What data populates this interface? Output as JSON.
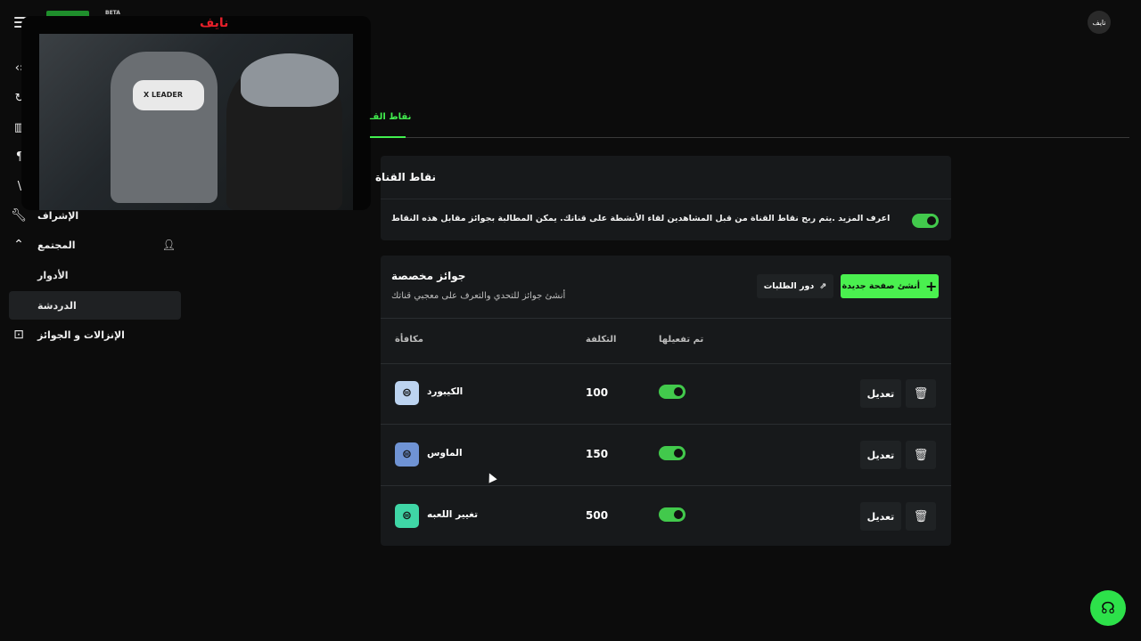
{
  "header": {
    "beta_label": "BETA",
    "user_initials": "نايف"
  },
  "stream_overlay": {
    "streamer_name": "نايف",
    "chair_brand": "X LEADER"
  },
  "sidebar": {
    "items": [
      {
        "label": "الإشراف",
        "icon": "wrench-icon"
      },
      {
        "label": "المجتمع",
        "icon": "chevron-up-icon"
      },
      {
        "label": "الأدوار"
      },
      {
        "label": "الدردشة"
      },
      {
        "label": "الإنزالات و الجوائز",
        "icon": "gift-drop-icon"
      }
    ]
  },
  "tab": {
    "active_label": "نقاط القـ"
  },
  "channel_points": {
    "title": "نقاط القناة",
    "description": "اعرف المزيد .يتم ربح نقاط القناة من قبل المشاهدين لقاء الأنشطة على قناتك. يمكن المطالبة بجوائز مقابل هذه النقاط",
    "enabled": true
  },
  "custom_rewards": {
    "title": "جوائز مخصصة",
    "subtitle": "أنشئ جوائز للتحدي والتعرف على معجبي قناتك",
    "create_button": "أنشئ صفحة جديدة",
    "queue_button": "دور الطلبات",
    "columns": {
      "reward": "مكافأة",
      "cost": "التكلفة",
      "enabled": "تم تفعيلها"
    },
    "edit_label": "تعديل",
    "rows": [
      {
        "name": "الكيبورد",
        "cost": "100",
        "enabled": true,
        "color": "#bcd3f0"
      },
      {
        "name": "الماوس",
        "cost": "150",
        "enabled": true,
        "color": "#6f93d4"
      },
      {
        "name": "تغيير اللعبه",
        "cost": "500",
        "enabled": true,
        "color": "#3fd6a6"
      }
    ]
  },
  "colors": {
    "accent": "#42f04f",
    "toggle_on": "#42c94c",
    "background": "#0c0c0c",
    "card": "#17191b"
  }
}
